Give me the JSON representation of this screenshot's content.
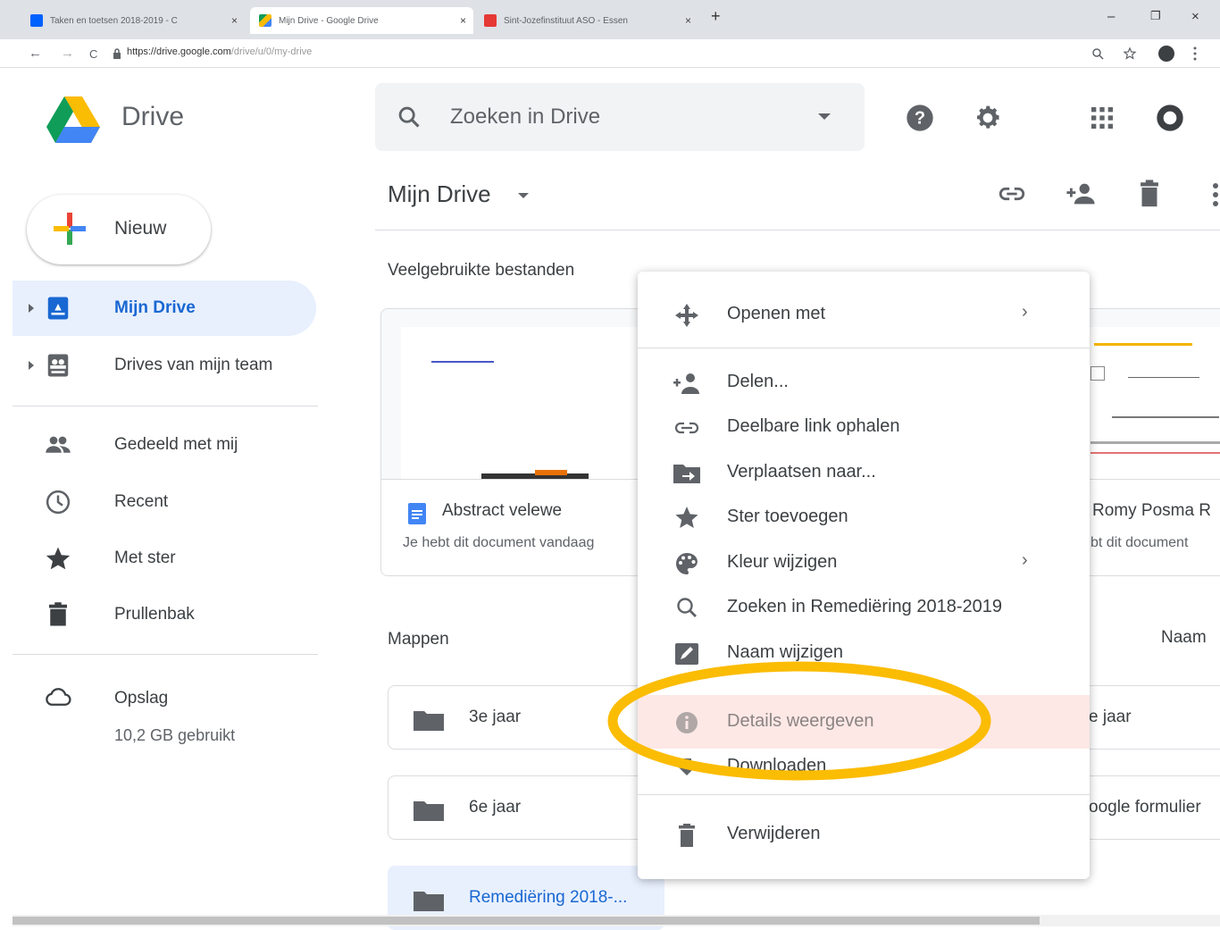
{
  "browser": {
    "tabs": [
      {
        "title": "Taken en toetsen 2018-2019 - C",
        "close": "×"
      },
      {
        "title": "Mijn Drive - Google Drive",
        "close": "×"
      },
      {
        "title": "Sint-Jozefinstituut ASO - Essen",
        "close": "×"
      }
    ],
    "new_tab": "+",
    "window_controls": [
      "–",
      "❐",
      "×"
    ],
    "nav": {
      "back": "←",
      "forward": "→",
      "reload": "C"
    },
    "url_host": "https://drive.google.com",
    "url_path": "/drive/u/0/my-drive"
  },
  "app": {
    "name": "Drive",
    "search_placeholder": "Zoeken in Drive"
  },
  "sidebar": {
    "new_label": "Nieuw",
    "items": [
      {
        "label": "Mijn Drive",
        "active": true
      },
      {
        "label": "Drives van mijn team"
      },
      {
        "label": "Gedeeld met mij"
      },
      {
        "label": "Recent"
      },
      {
        "label": "Met ster"
      },
      {
        "label": "Prullenbak"
      }
    ],
    "storage_label": "Opslag",
    "storage_used": "10,2 GB gebruikt"
  },
  "main": {
    "title": "Mijn Drive",
    "frequent_heading": "Veelgebruikte bestanden",
    "cards": [
      {
        "name": "Abstract velewe",
        "sub": "Je hebt dit document vandaag"
      },
      {
        "name": "Romy Posma R",
        "sub": "bt dit document"
      }
    ],
    "folders_heading": "Mappen",
    "sort_label": "Naam",
    "folders": [
      {
        "label": "3e jaar"
      },
      {
        "label": "e jaar"
      },
      {
        "label": "6e jaar"
      },
      {
        "label": "oogle formulier"
      },
      {
        "label": "Remediëring 2018-..."
      }
    ]
  },
  "context_menu": {
    "items": [
      {
        "label": "Openen met",
        "icon": "open-with-icon",
        "submenu": "›"
      },
      {
        "label": "Delen...",
        "icon": "share-icon"
      },
      {
        "label": "Deelbare link ophalen",
        "icon": "link-icon"
      },
      {
        "label": "Verplaatsen naar...",
        "icon": "move-icon"
      },
      {
        "label": "Ster toevoegen",
        "icon": "star-icon"
      },
      {
        "label": "Kleur wijzigen",
        "icon": "palette-icon",
        "submenu": "›"
      },
      {
        "label": "Zoeken in Remediëring 2018-2019",
        "icon": "search-icon"
      },
      {
        "label": "Naam wijzigen",
        "icon": "rename-icon"
      },
      {
        "label": "Details weergeven",
        "icon": "info-icon"
      },
      {
        "label": "Downloaden",
        "icon": "download-icon"
      },
      {
        "label": "Verwijderen",
        "icon": "trash-icon"
      }
    ],
    "highlight_color": "#FBBC04"
  }
}
